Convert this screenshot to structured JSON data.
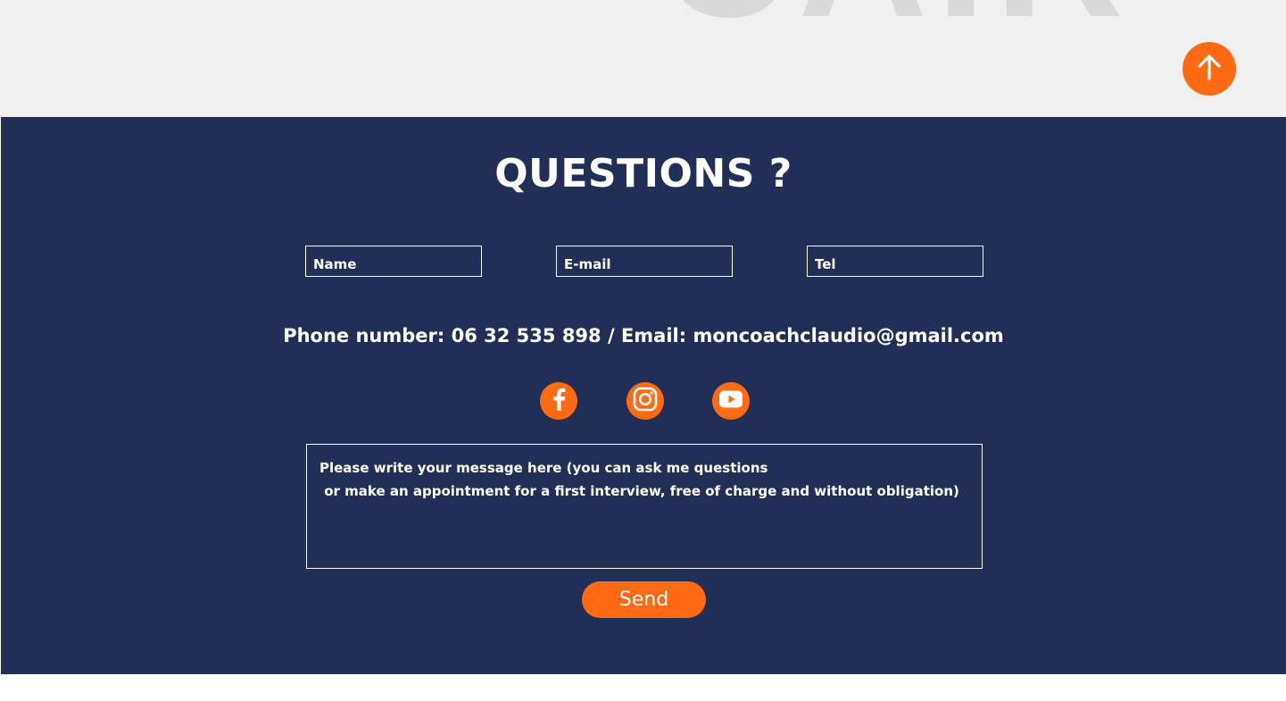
{
  "header": {
    "background_letters": "CAIR",
    "scroll_top_icon": "arrow-up-icon"
  },
  "footer": {
    "title": "QUESTIONS ?",
    "form": {
      "name_placeholder": "Name",
      "email_placeholder": "E-mail",
      "tel_placeholder": "Tel",
      "message_line_1": "Please write your message here (you can ask me questions",
      "message_line_2": " or make an appointment for a first interview, free of charge and without obligation)",
      "send_label": "Send"
    },
    "contact_line": "Phone number: 06 32 535 898 / Email: moncoachclaudio@gmail.com",
    "social": [
      "facebook-icon",
      "instagram-icon",
      "youtube-icon"
    ]
  },
  "colors": {
    "accent": "#ff6a13",
    "footer_bg": "#212f56",
    "top_band_bg": "#f0f0f0"
  }
}
